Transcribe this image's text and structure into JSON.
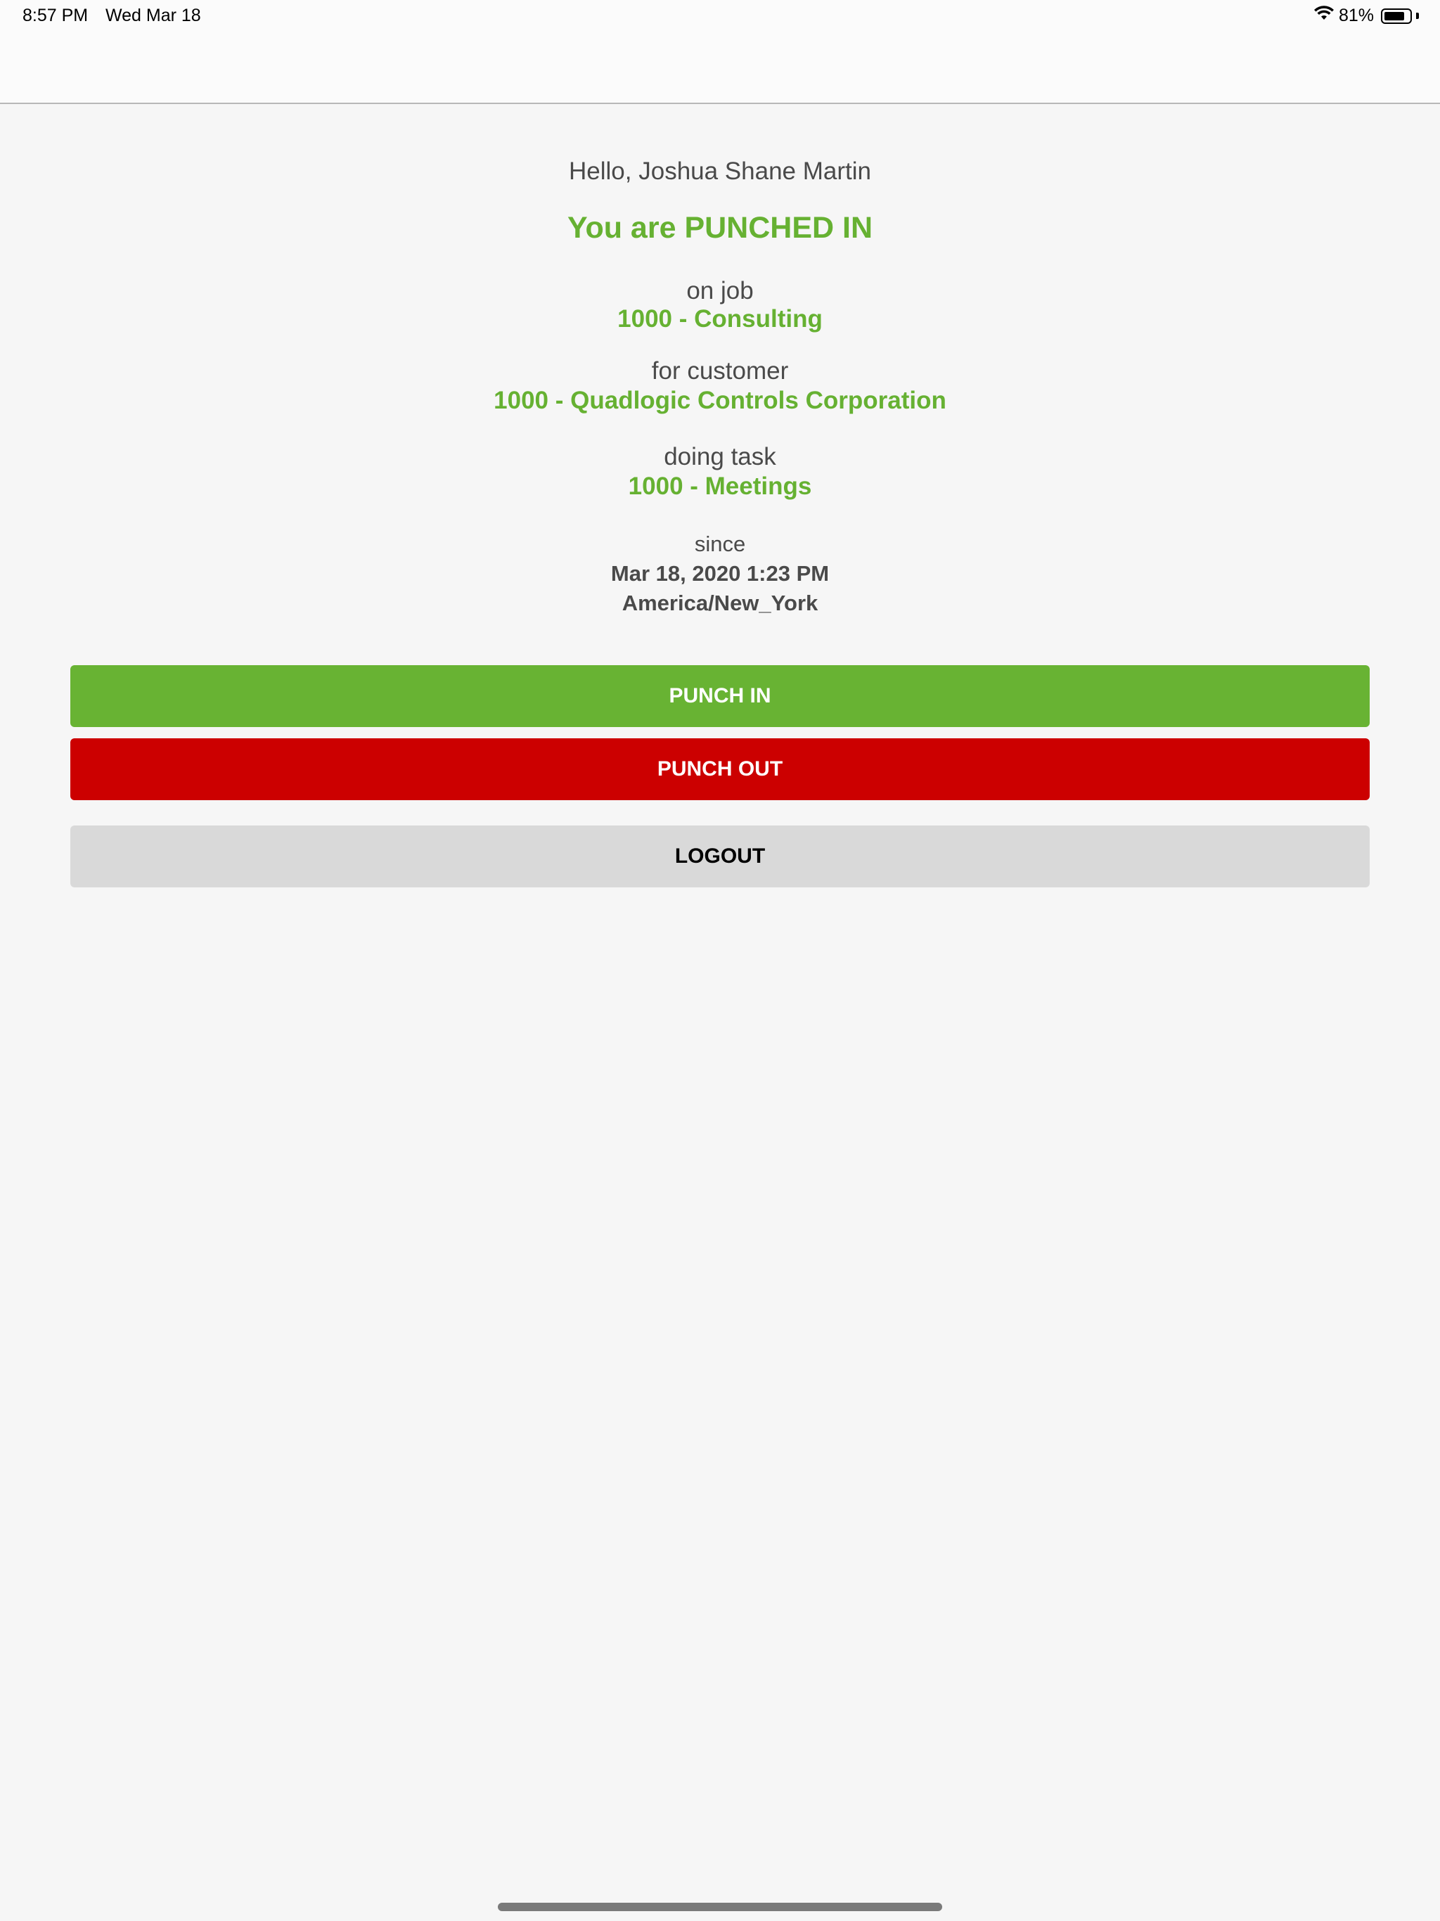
{
  "status_bar": {
    "time": "8:57 PM",
    "date": "Wed Mar 18",
    "battery_text": "81%",
    "battery_level": 0.81
  },
  "main": {
    "greeting": "Hello, Joshua Shane Martin",
    "status": "You are PUNCHED IN",
    "job_label": "on job",
    "job_value": "1000 - Consulting",
    "customer_label": "for customer",
    "customer_value": "1000 - Quadlogic Controls Corporation",
    "task_label": "doing task",
    "task_value": "1000 - Meetings",
    "since_label": "since",
    "since_datetime": "Mar 18, 2020 1:23 PM",
    "since_timezone": "America/New_York"
  },
  "buttons": {
    "punch_in": "PUNCH IN",
    "punch_out": "PUNCH OUT",
    "logout": "LOGOUT"
  },
  "colors": {
    "accent_green": "#66b132",
    "punch_in_bg": "#68b333",
    "punch_out_bg": "#cc0000",
    "logout_bg": "#d9d9d9"
  }
}
